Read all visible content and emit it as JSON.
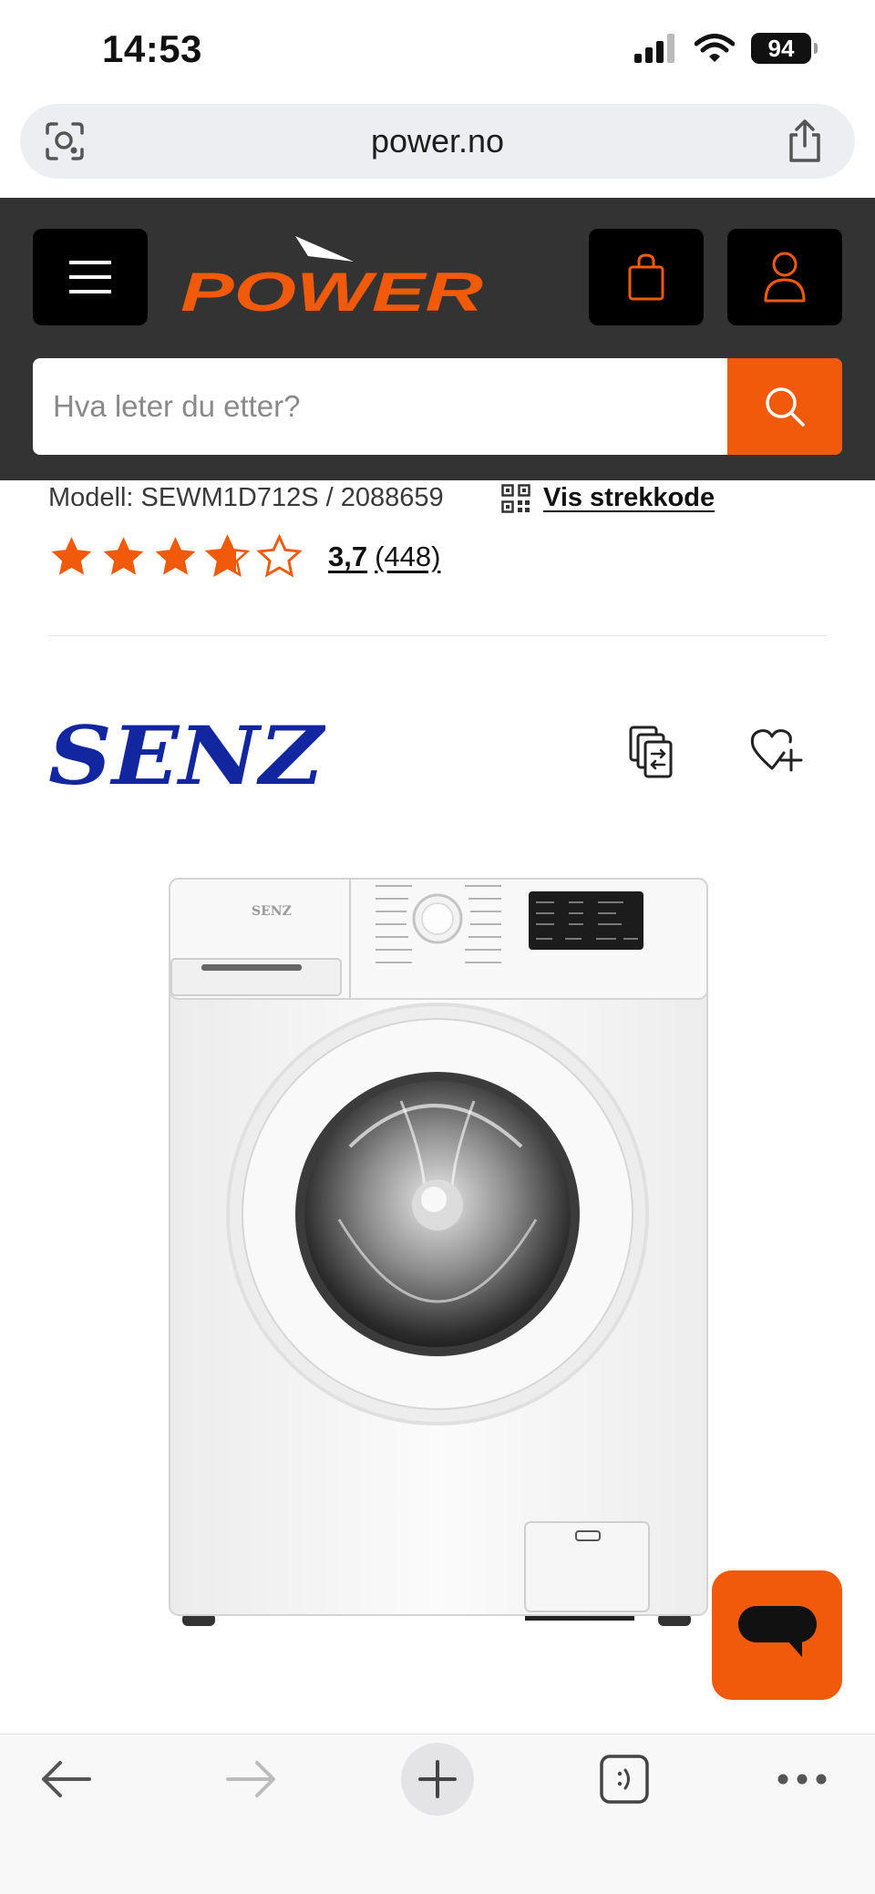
{
  "status_bar": {
    "time": "14:53",
    "battery": "94"
  },
  "browser": {
    "url": "power.no"
  },
  "header": {
    "logo_text": "POWER",
    "search_placeholder": "Hva leter du etter?"
  },
  "product": {
    "model_line": "Modell: SEWM1D712S / 2088659",
    "barcode_link": "Vis strekkode",
    "rating": 3.7,
    "rating_max": 5,
    "rating_text": "3,7",
    "review_count": "(448)",
    "brand": "SENZ"
  },
  "colors": {
    "accent": "#f05a0a",
    "header_bg": "#333333",
    "brand_blue": "#1226a0"
  },
  "icons": [
    "lens-icon",
    "share-icon",
    "menu-icon",
    "cart-icon",
    "user-icon",
    "search-icon",
    "qr-code-icon",
    "star-icon",
    "compare-icon",
    "heart-plus-icon",
    "chat-icon",
    "back-arrow-icon",
    "forward-arrow-icon",
    "plus-icon",
    "tabs-icon",
    "more-icon"
  ]
}
